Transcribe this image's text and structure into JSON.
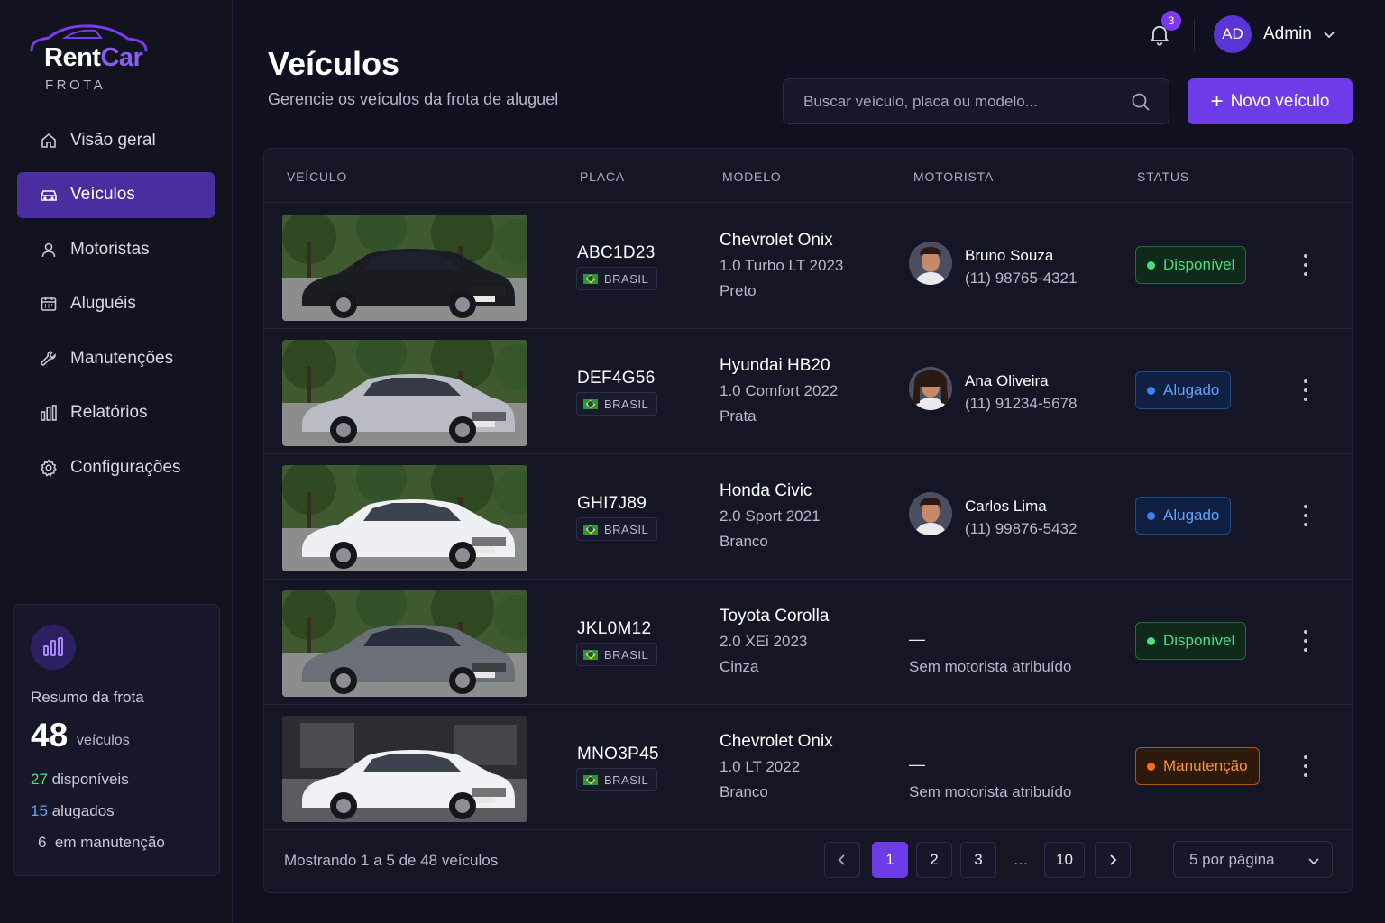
{
  "brand": {
    "name_part1": "Rent",
    "name_part2": "Car",
    "subtitle": "FROTA",
    "accent": "#7c3aed"
  },
  "sidebar": {
    "items": [
      {
        "label": "Visão geral",
        "icon": "home-icon",
        "active": false
      },
      {
        "label": "Veículos",
        "icon": "car-icon",
        "active": true
      },
      {
        "label": "Motoristas",
        "icon": "user-icon",
        "active": false
      },
      {
        "label": "Aluguéis",
        "icon": "calendar-icon",
        "active": false
      },
      {
        "label": "Manutenções",
        "icon": "wrench-icon",
        "active": false
      },
      {
        "label": "Relatórios",
        "icon": "bar-chart-icon",
        "active": false
      },
      {
        "label": "Configurações",
        "icon": "gear-icon",
        "active": false
      }
    ],
    "summary": {
      "title": "Resumo da frota",
      "total": "48",
      "total_unit": "veículos",
      "available_count": "27",
      "available_label": "disponíveis",
      "rented_count": "15",
      "rented_label": "alugados",
      "maintenance_count": "6",
      "maintenance_label": "em manutenção"
    }
  },
  "topbar": {
    "notifications": "3",
    "avatar_initials": "AD",
    "user_name": "Admin"
  },
  "page": {
    "title": "Veículos",
    "subtitle": "Gerencie os veículos da frota de aluguel",
    "search_placeholder": "Buscar veículo, placa ou modelo...",
    "new_button": "Novo veículo"
  },
  "table": {
    "columns": [
      "VEÍCULO",
      "PLACA",
      "MODELO",
      "MOTORISTA",
      "STATUS"
    ],
    "rows": [
      {
        "plate": "ABC1D23",
        "country": "BRASIL",
        "model": "Chevrolet Onix",
        "version": "1.0 Turbo LT 2023",
        "color": "Preto",
        "driver": "Bruno Souza",
        "phone": "(11) 98765-4321",
        "status": "Disponível",
        "status_type": "disp",
        "car_color": "#1a1c22",
        "bg": "park"
      },
      {
        "plate": "DEF4G56",
        "country": "BRASIL",
        "model": "Hyundai HB20",
        "version": "1.0 Comfort 2022",
        "color": "Prata",
        "driver": "Ana Oliveira",
        "phone": "(11) 91234-5678",
        "status": "Alugado",
        "status_type": "alug",
        "car_color": "#b9bcc2",
        "bg": "park"
      },
      {
        "plate": "GHI7J89",
        "country": "BRASIL",
        "model": "Honda Civic",
        "version": "2.0 Sport 2021",
        "color": "Branco",
        "driver": "Carlos Lima",
        "phone": "(11) 99876-5432",
        "status": "Alugado",
        "status_type": "alug",
        "car_color": "#eef0f3",
        "bg": "park"
      },
      {
        "plate": "JKL0M12",
        "country": "BRASIL",
        "model": "Toyota Corolla",
        "version": "2.0 XEi 2023",
        "color": "Cinza",
        "driver_empty_dash": "—",
        "driver_empty": "Sem motorista atribuído",
        "status": "Disponível",
        "status_type": "disp",
        "car_color": "#6b6f78",
        "bg": "park"
      },
      {
        "plate": "MNO3P45",
        "country": "BRASIL",
        "model": "Chevrolet Onix",
        "version": "1.0 LT 2022",
        "color": "Branco",
        "driver_empty_dash": "—",
        "driver_empty": "Sem motorista atribuído",
        "status": "Manutenção",
        "status_type": "man",
        "car_color": "#f0f1f3",
        "bg": "garage"
      }
    ],
    "footer": "Mostrando 1 a 5 de 48 veículos",
    "pages": [
      "1",
      "2",
      "3",
      "…",
      "10"
    ],
    "current_page": "1",
    "per_page": "5 por página"
  }
}
